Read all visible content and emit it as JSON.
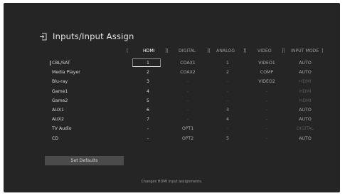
{
  "header": {
    "title": "Inputs/Input Assign",
    "icon": "input-icon"
  },
  "columns": {
    "open_hdmi": "[",
    "hdmi": "HDMI",
    "sep1": "][",
    "digital": "DIGITAL",
    "sep2": "][",
    "analog": "ANALOG",
    "sep3": "][",
    "video": "VIDEO",
    "sep4": "][",
    "input_mode": "INPUT MODE",
    "close": "]"
  },
  "rows": [
    {
      "label": "CBL/SAT",
      "hdmi": "1",
      "digital": "COAX1",
      "analog": "1",
      "video": "VIDEO1",
      "mode": "AUTO",
      "selected": true
    },
    {
      "label": "Media Player",
      "hdmi": "2",
      "digital": "COAX2",
      "analog": "2",
      "video": "COMP",
      "mode": "AUTO"
    },
    {
      "label": "Blu-ray",
      "hdmi": "3",
      "digital": "-",
      "analog": "-",
      "video": "VIDEO2",
      "mode": "HDMI"
    },
    {
      "label": "Game1",
      "hdmi": "4",
      "digital": "-",
      "analog": "-",
      "video": "-",
      "mode": "HDMI"
    },
    {
      "label": "Game2",
      "hdmi": "5",
      "digital": "-",
      "analog": "-",
      "video": "-",
      "mode": "HDMI"
    },
    {
      "label": "AUX1",
      "hdmi": "6",
      "digital": "-",
      "analog": "3",
      "video": "-",
      "mode": "AUTO"
    },
    {
      "label": "AUX2",
      "hdmi": "7",
      "digital": "-",
      "analog": "4",
      "video": "-",
      "mode": "AUTO"
    },
    {
      "label": "TV Audio",
      "hdmi": "-",
      "digital": "OPT1",
      "analog": "-",
      "video": "-",
      "mode": "DIGITAL"
    },
    {
      "label": "CD",
      "hdmi": "-",
      "digital": "OPT2",
      "analog": "5",
      "video": "-",
      "mode": "AUTO"
    }
  ],
  "set_defaults_label": "Set Defaults",
  "footer_hint": "Changes HDMI input assignments."
}
